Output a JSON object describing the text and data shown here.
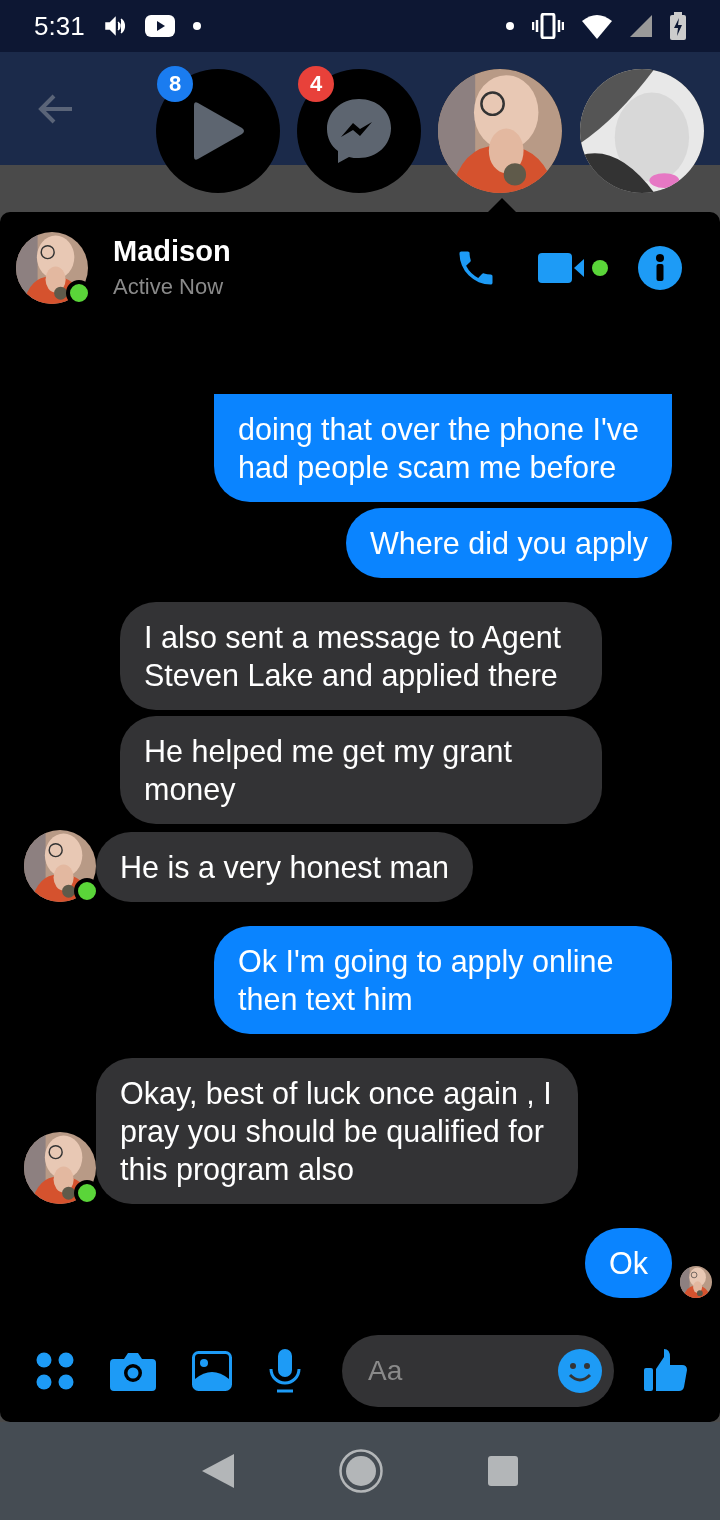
{
  "status_bar": {
    "time": "5:31"
  },
  "chat_heads": [
    {
      "kind": "app",
      "badge": "8"
    },
    {
      "kind": "messenger",
      "badge": "4"
    },
    {
      "kind": "person",
      "selected": true
    },
    {
      "kind": "person",
      "selected": false
    }
  ],
  "contact": {
    "name": "Madison",
    "status": "Active Now",
    "active": true
  },
  "messages": [
    {
      "kind": "outgoing",
      "text": "doing that over the phone I've had people scam me before",
      "seen": false
    },
    {
      "kind": "outgoing",
      "text": "Where did you apply",
      "seen": false
    },
    {
      "kind": "incoming",
      "text": "I also sent a message to Agent Steven Lake and applied there",
      "avatar": false
    },
    {
      "kind": "incoming",
      "text": "He helped me get my grant money",
      "avatar": false
    },
    {
      "kind": "incoming",
      "text": "He is a very honest man",
      "avatar": true
    },
    {
      "kind": "outgoing",
      "text": "Ok I'm going to apply online then text him",
      "seen": false
    },
    {
      "kind": "incoming",
      "text": "Okay, best of luck once again , I pray you should be qualified for this program also",
      "avatar": true
    },
    {
      "kind": "outgoing",
      "text": "Ok",
      "seen": true
    }
  ],
  "composer": {
    "placeholder": "Aa"
  }
}
